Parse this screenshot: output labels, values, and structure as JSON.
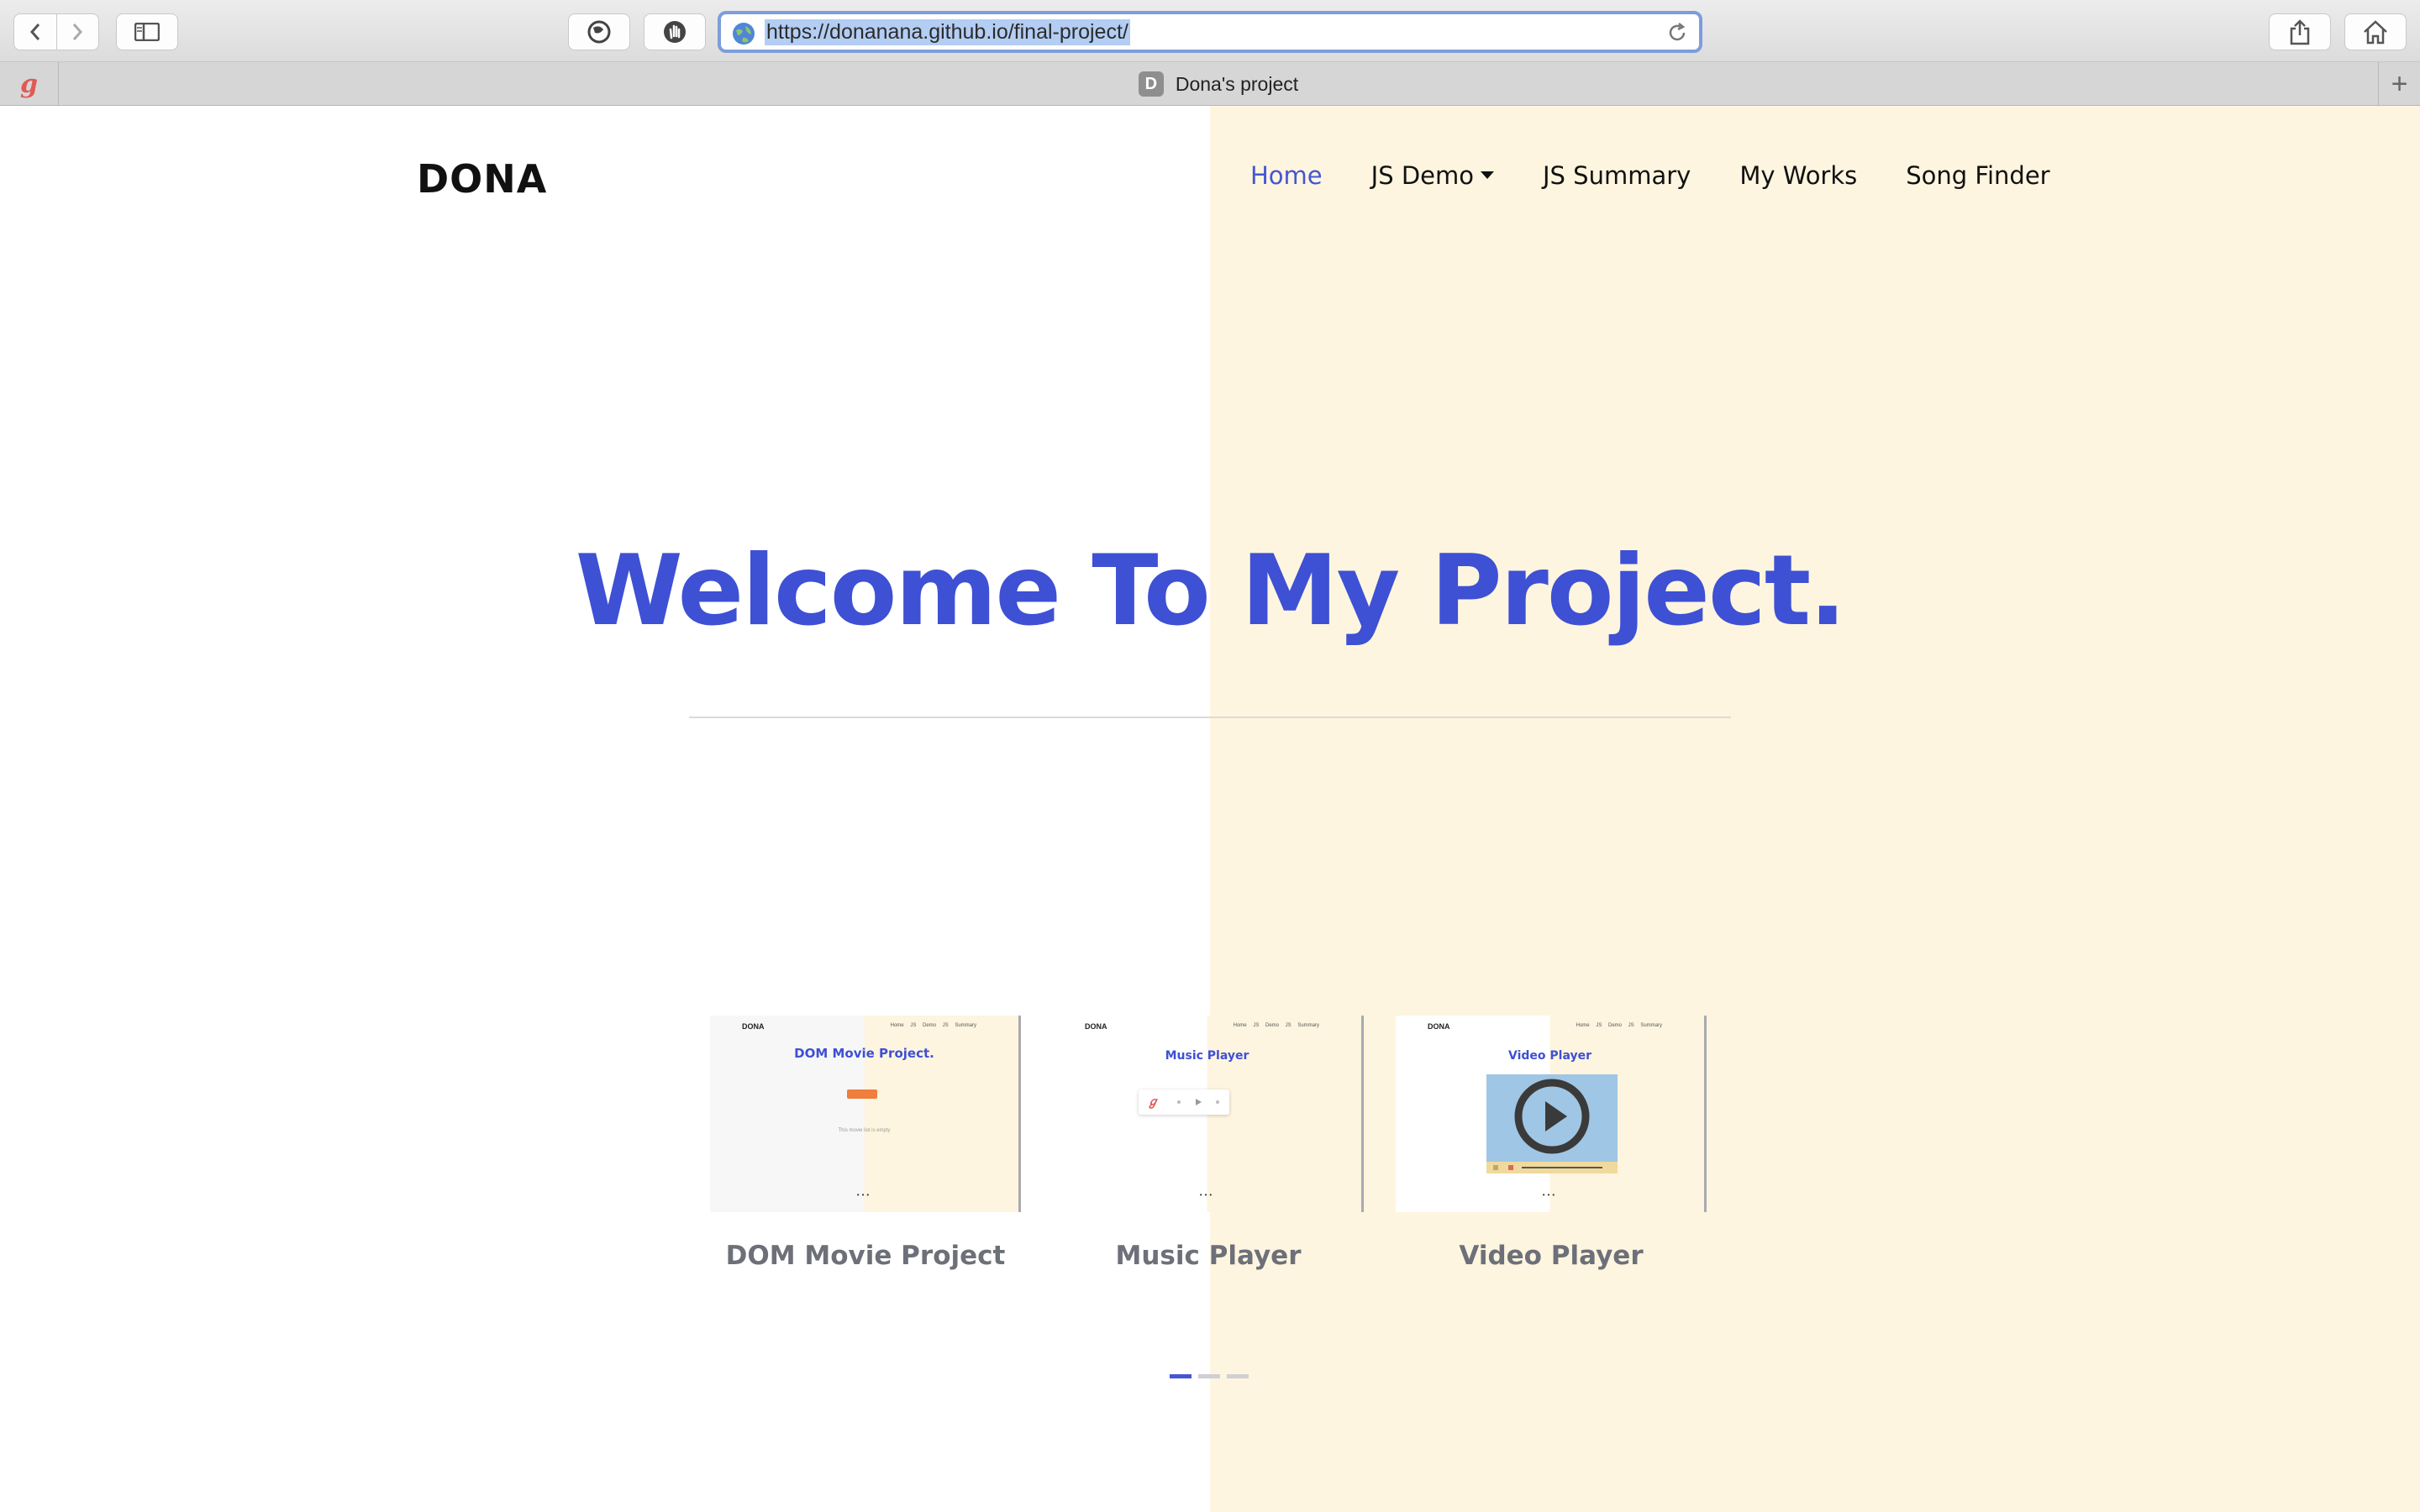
{
  "browser": {
    "url": "https://donanana.github.io/final-project/",
    "tab_title": "Dona's project",
    "tab_favicon_letter": "D",
    "pinned_tab_letter": "g",
    "new_tab_label": "+",
    "colors": {
      "url_focus": "#7d9ddc",
      "selection": "#b3cdf3"
    }
  },
  "site": {
    "brand": "DONA",
    "nav": [
      {
        "label": "Home",
        "active": true
      },
      {
        "label": "JS Demo",
        "dropdown": true
      },
      {
        "label": "JS Summary"
      },
      {
        "label": "My Works"
      },
      {
        "label": "Song Finder"
      }
    ],
    "hero_title": "Welcome To My Project.",
    "cards": [
      {
        "title": "DOM Movie Project",
        "preview": {
          "brand": "DONA",
          "nav": "Home JS Demo JS Summary",
          "title": "DOM Movie Project.",
          "button": "",
          "caption": "This movie list is empty"
        }
      },
      {
        "title": "Music Player",
        "preview": {
          "brand": "DONA",
          "nav": "Home JS Demo JS Summary",
          "title": "Music Player"
        }
      },
      {
        "title": "Video Player",
        "preview": {
          "brand": "DONA",
          "nav": "Home JS Demo JS Summary",
          "title": "Video Player"
        }
      }
    ],
    "carousel": {
      "slides": 3,
      "active_index": 0
    },
    "colors": {
      "accent": "#3e50d4",
      "right_panel": "#fdf5df",
      "card_title": "#6d7079"
    }
  }
}
